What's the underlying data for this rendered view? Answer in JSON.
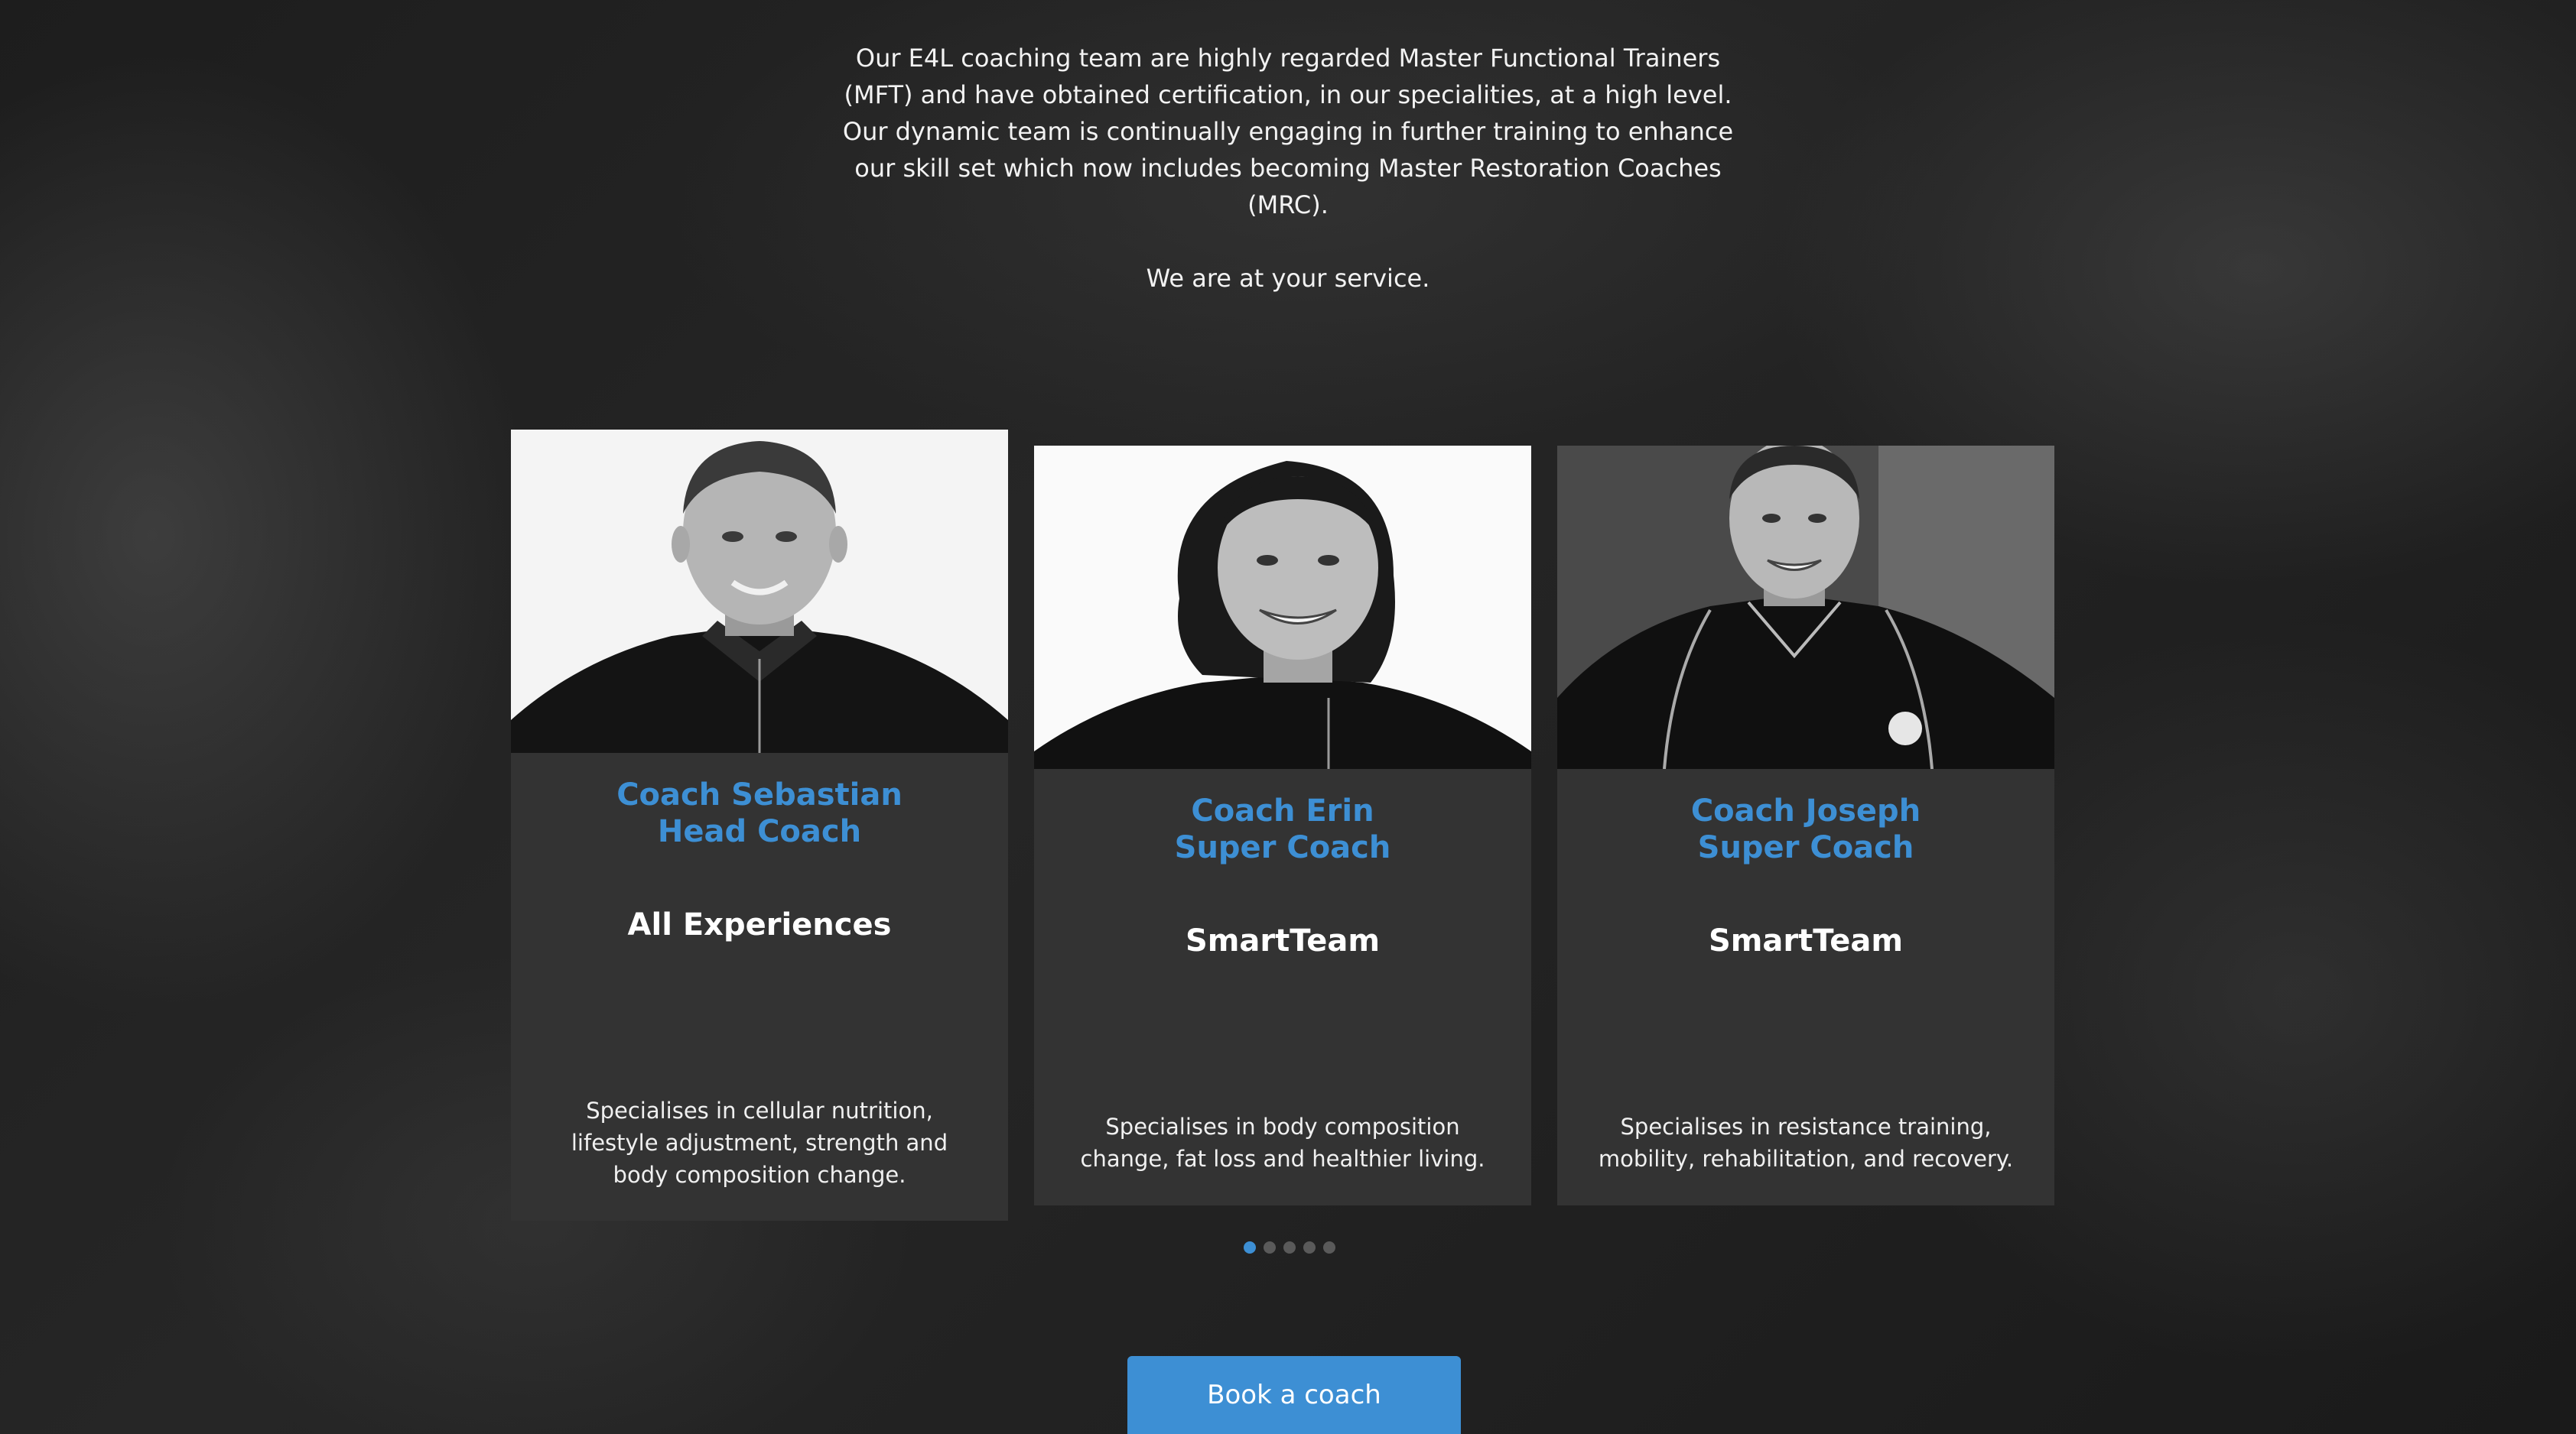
{
  "intro": {
    "paragraph": "Our E4L coaching team are highly regarded Master Functional Trainers (MFT) and have obtained certification, in our specialities, at a high level. Our dynamic team is continually engaging in further training to enhance our skill set which now includes becoming Master Restoration Coaches (MRC).",
    "tagline": "We are at your service."
  },
  "coaches": [
    {
      "name": "Coach Sebastian",
      "role": "Head Coach",
      "program": "All Experiences",
      "description": "Specialises in cellular nutrition, lifestyle adjustment, strength and body composition change."
    },
    {
      "name": "Coach Erin",
      "role": "Super Coach",
      "program": "SmartTeam",
      "description": "Specialises in body composition change, fat loss and healthier living."
    },
    {
      "name": "Coach Joseph",
      "role": "Super Coach",
      "program": "SmartTeam",
      "description": "Specialises in resistance training, mobility, rehabilitation, and recovery."
    }
  ],
  "carousel": {
    "total_pages": 5,
    "active_page": 1
  },
  "cta": {
    "book_label": "Book a coach"
  },
  "colors": {
    "accent": "#3d8fd4",
    "card_background": "#333333",
    "page_background": "#1f1f1f"
  }
}
